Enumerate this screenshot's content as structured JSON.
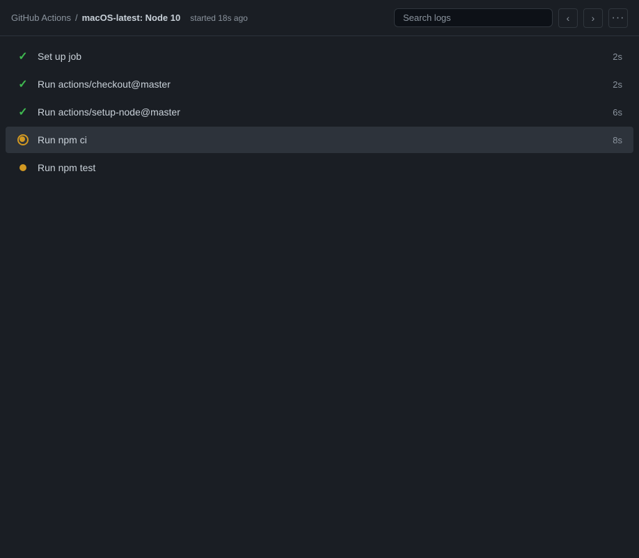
{
  "header": {
    "breadcrumb_prefix": "GitHub Actions",
    "breadcrumb_separator": "/",
    "breadcrumb_title": "macOS-latest: Node 10",
    "started_label": "started 18s ago",
    "search_placeholder": "Search logs"
  },
  "toolbar": {
    "prev_label": "‹",
    "next_label": "›",
    "more_label": "···"
  },
  "jobs": [
    {
      "id": 1,
      "name": "Set up job",
      "duration": "2s",
      "status": "success",
      "active": false
    },
    {
      "id": 2,
      "name": "Run actions/checkout@master",
      "duration": "2s",
      "status": "success",
      "active": false
    },
    {
      "id": 3,
      "name": "Run actions/setup-node@master",
      "duration": "6s",
      "status": "success",
      "active": false
    },
    {
      "id": 4,
      "name": "Run npm ci",
      "duration": "8s",
      "status": "running",
      "active": true
    },
    {
      "id": 5,
      "name": "Run npm test",
      "duration": "",
      "status": "pending",
      "active": false
    }
  ]
}
